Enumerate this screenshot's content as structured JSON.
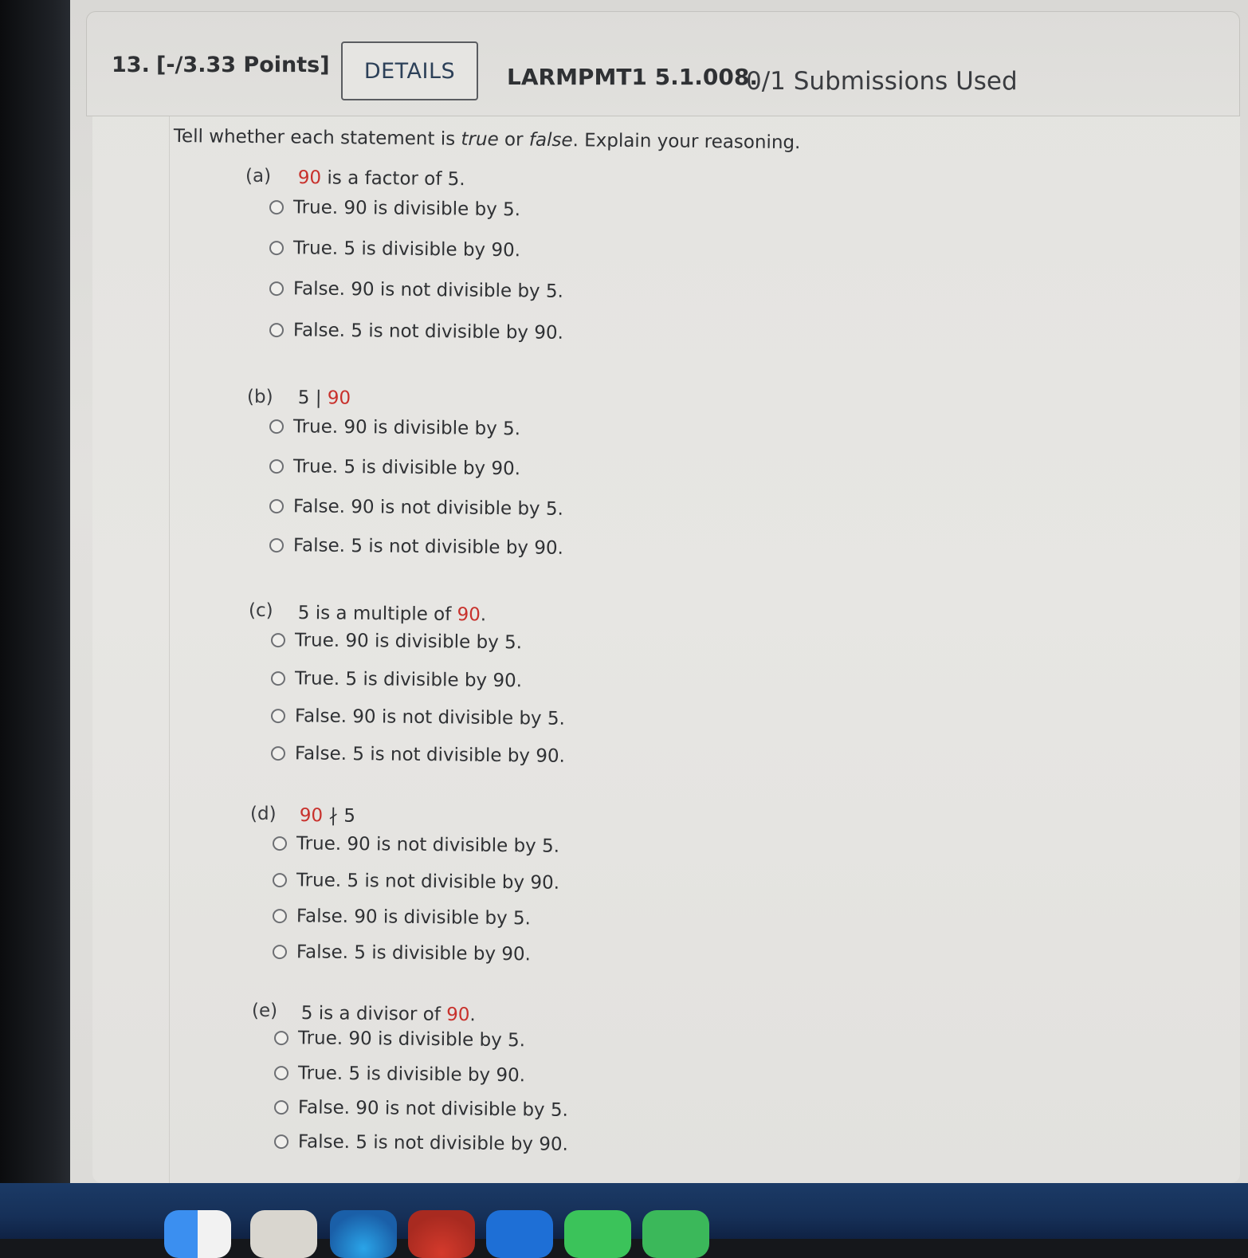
{
  "question": {
    "number": "13.",
    "points": "[-/3.33 Points]",
    "details_label": "DETAILS",
    "problem_id": "LARMPMT1 5.1.008.",
    "submissions": "0/1 Submissions Used",
    "instructions": {
      "prefix": "Tell whether each statement is ",
      "word_true": "true",
      "middle": " or ",
      "word_false": "false",
      "suffix": ". Explain your reasoning."
    }
  },
  "parts": {
    "a": {
      "label": "(a)",
      "stmt": {
        "s1": "90",
        "s2": " is a factor of 5."
      },
      "options": [
        "True. 90 is divisible by 5.",
        "True. 5 is divisible by 90.",
        "False. 90 is not divisible by 5.",
        "False. 5 is not divisible by 90."
      ]
    },
    "b": {
      "label": "(b)",
      "stmt": {
        "s1": "5 | ",
        "s2": "90"
      },
      "options": [
        "True. 90 is divisible by 5.",
        "True. 5 is divisible by 90.",
        "False. 90 is not divisible by 5.",
        "False. 5 is not divisible by 90."
      ]
    },
    "c": {
      "label": "(c)",
      "stmt": {
        "s1": "5 is a multiple of ",
        "s2": "90",
        "s3": "."
      },
      "options": [
        "True. 90 is divisible by 5.",
        "True. 5 is divisible by 90.",
        "False. 90 is not divisible by 5.",
        "False. 5 is not divisible by 90."
      ]
    },
    "d": {
      "label": "(d)",
      "stmt": {
        "s1": "90",
        "s2": " ∤ 5"
      },
      "options": [
        "True. 90 is not divisible by 5.",
        "True. 5 is not divisible by 90.",
        "False. 90 is divisible by 5.",
        "False. 5 is divisible by 90."
      ]
    },
    "e": {
      "label": "(e)",
      "stmt": {
        "s1": "5 is a divisor of ",
        "s2": "90",
        "s3": "."
      },
      "options": [
        "True. 90 is divisible by 5.",
        "True. 5 is divisible by 90.",
        "False. 90 is not divisible by 5.",
        "False. 5 is not divisible by 90."
      ]
    }
  },
  "colors": {
    "accent_red": "#c8312c",
    "text": "#2f3134",
    "details_text": "#2c4058",
    "dock": "#163058"
  },
  "icons": {
    "radio": "radio-circle-icon",
    "dock": [
      "finder-icon",
      "launchpad-icon",
      "safari-icon",
      "chrome-icon",
      "mail-icon",
      "messages-icon"
    ]
  }
}
